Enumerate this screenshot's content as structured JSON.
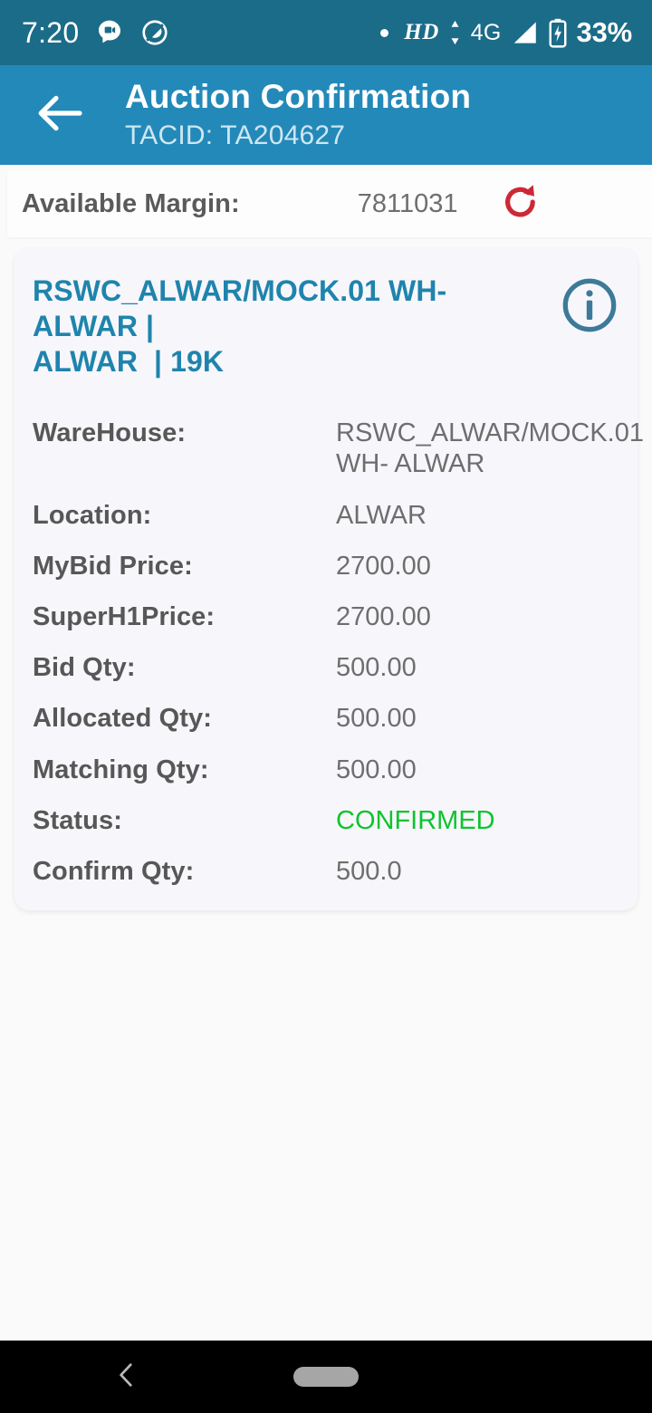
{
  "status_bar": {
    "time": "7:20",
    "icons_left": [
      "video-message-icon",
      "do-not-disturb-icon"
    ],
    "separator_dot": "•",
    "hd": "HD",
    "data_arrows": "data-transfer-arrows-icon",
    "network": "4G",
    "signal": "signal-bars-icon",
    "battery": "battery-charging-icon",
    "battery_pct": "33%",
    "background_color": "#1b6c88"
  },
  "app_bar": {
    "back_icon": "back-arrow-icon",
    "title": "Auction Confirmation",
    "subtitle": "TACID: TA204627",
    "background_color": "#2389b9"
  },
  "margin_bar": {
    "label": "Available Margin:",
    "value": "7811031",
    "refresh_icon": "refresh-icon",
    "refresh_color": "#cc2936"
  },
  "card": {
    "title": "RSWC_ALWAR/MOCK.01 WH- ALWAR |\nALWAR  | 19K",
    "title_color": "#1f84ad",
    "info_icon": "info-icon",
    "rows": [
      {
        "label": "WareHouse:",
        "value": "RSWC_ALWAR/MOCK.01\nWH- ALWAR"
      },
      {
        "label": "Location:",
        "value": "ALWAR"
      },
      {
        "label": "MyBid Price:",
        "value": "2700.00"
      },
      {
        "label": "SuperH1Price:",
        "value": "2700.00"
      },
      {
        "label": "Bid Qty:",
        "value": "500.00"
      },
      {
        "label": "Allocated Qty:",
        "value": "500.00"
      },
      {
        "label": "Matching Qty:",
        "value": "500.00"
      },
      {
        "label": "Status:",
        "value": "CONFIRMED"
      },
      {
        "label": "Confirm Qty:",
        "value": "500.0"
      }
    ],
    "status_color": "#0cc42e"
  },
  "nav_bar": {
    "back_icon": "nav-back-icon",
    "home_pill": "home-pill-handle",
    "background_color": "#000000"
  }
}
